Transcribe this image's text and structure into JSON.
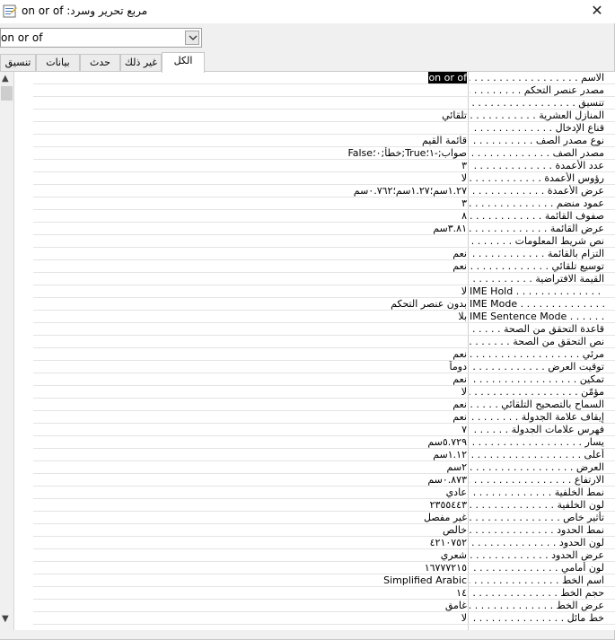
{
  "window": {
    "title": "مربع تحرير وسرد: on or of",
    "close_glyph": "✕"
  },
  "selector": {
    "value": "on or of"
  },
  "tabs": [
    "الكل",
    "غير ذلك",
    "حدث",
    "بيانات",
    "تنسيق"
  ],
  "properties": [
    {
      "label": "الاسم . . . . . . . . . . . . . . . . . . . . . .",
      "value": "on or of"
    },
    {
      "label": "مصدر عنصر التحكم . . . . . . . . . .",
      "value": ""
    },
    {
      "label": "تنسيق . . . . . . . . . . . . . . . . . . . . .",
      "value": ""
    },
    {
      "label": "المنازل العشرية . . . . . . . . . . . . . .",
      "value": "تلقائي"
    },
    {
      "label": "قناع الإدخال . . . . . . . . . . . . . . . . .",
      "value": ""
    },
    {
      "label": "نوع مصدر الصف . . . . . . . . . . . .",
      "value": "قائمة القيم"
    },
    {
      "label": "مصدر الصف . . . . . . . . . . . . . . .",
      "value": "صواب;-١؛True;خطأ;٠؛False"
    },
    {
      "label": "عدد الأعمدة . . . . . . . . . . . . . . . . .",
      "value": "٣"
    },
    {
      "label": "رؤوس الأعمدة . . . . . . . . . . . . . . .",
      "value": "لا"
    },
    {
      "label": "عرض الأعمدة . . . . . . . . . . . . . . .",
      "value": "١.٢٧سم؛١.٢٧سم؛٠.٧٦٢سم"
    },
    {
      "label": "عمود منضم . . . . . . . . . . . . . . . . .",
      "value": "٣"
    },
    {
      "label": "صفوف القائمة . . . . . . . . . . . . . . .",
      "value": "٨"
    },
    {
      "label": "عرض القائمة . . . . . . . . . . . . . . . .",
      "value": "٣.٨١سم"
    },
    {
      "label": "نص شريط المعلومات . . . . . . . . .",
      "value": ""
    },
    {
      "label": "التزام بالقائمة . . . . . . . . . . . . . . .",
      "value": "نعم"
    },
    {
      "label": "توسيع تلقائي . . . . . . . . . . . . . . . .",
      "value": "نعم"
    },
    {
      "label": "القيمة الافتراضية . . . . . . . . . . . . .",
      "value": ""
    },
    {
      "label": "IME Hold . . . . . . . . . . . . . . . . . . . .",
      "value": "لا"
    },
    {
      "label": "IME Mode . . . . . . . . . . . . . . . . . .",
      "value": "بدون عنصر التحكم"
    },
    {
      "label": "IME Sentence Mode . . . . . . . . . .",
      "value": "بلا"
    },
    {
      "label": "قاعدة التحقق من الصحة . . . . . . .",
      "value": ""
    },
    {
      "label": "نص التحقق من الصحة . . . . . . . .",
      "value": ""
    },
    {
      "label": "مرئي . . . . . . . . . . . . . . . . . . . . . . .",
      "value": "نعم"
    },
    {
      "label": "توقيت العرض . . . . . . . . . . . . . . .",
      "value": "دوماً"
    },
    {
      "label": "تمكين . . . . . . . . . . . . . . . . . . . . . .",
      "value": "نعم"
    },
    {
      "label": "مؤمّن . . . . . . . . . . . . . . . . . . . . . .",
      "value": "لا"
    },
    {
      "label": "السماح بالتصحيح التلقائي . . . . .",
      "value": "نعم"
    },
    {
      "label": "إيقاف علامة الجدولة . . . . . . . . .",
      "value": "نعم"
    },
    {
      "label": "فهرس علامات الجدولة . . . . . . . .",
      "value": "٧"
    },
    {
      "label": "يسار . . . . . . . . . . . . . . . . . . . . . . .",
      "value": "٥.٧٢٩سم"
    },
    {
      "label": "أعلى . . . . . . . . . . . . . . . . . . . . . . .",
      "value": "١.١٢سم"
    },
    {
      "label": "العرض . . . . . . . . . . . . . . . . . . . . .",
      "value": "٢سم"
    },
    {
      "label": "الارتفاع . . . . . . . . . . . . . . . . . . . .",
      "value": "٠.٨٧٣سم"
    },
    {
      "label": "نمط الخلفية . . . . . . . . . . . . . . . .",
      "value": "عادي"
    },
    {
      "label": "لون الخلفية . . . . . . . . . . . . . . . .",
      "value": "٢٣٥٥٤٤٣"
    },
    {
      "label": "تأثير خاص . . . . . . . . . . . . . . . . .",
      "value": "غير مفصل"
    },
    {
      "label": "نمط الحدود . . . . . . . . . . . . . . . .",
      "value": "خالص"
    },
    {
      "label": "لون الحدود . . . . . . . . . . . . . . . .",
      "value": "٤٢١٠٧٥٢"
    },
    {
      "label": "عرض الحدود . . . . . . . . . . . . . . .",
      "value": "شعري"
    },
    {
      "label": "لون أمامي . . . . . . . . . . . . . . . . .",
      "value": "١٦٧٧٧٢١٥"
    },
    {
      "label": "اسم الخط . . . . . . . . . . . . . . . . .",
      "value": "Simplified Arabic"
    },
    {
      "label": "حجم الخط . . . . . . . . . . . . . . . . .",
      "value": "١٤"
    },
    {
      "label": "عرض الخط . . . . . . . . . . . . . . . .",
      "value": "غامق"
    },
    {
      "label": "خط مائل . . . . . . . . . . . . . . . . . .",
      "value": "لا"
    }
  ]
}
